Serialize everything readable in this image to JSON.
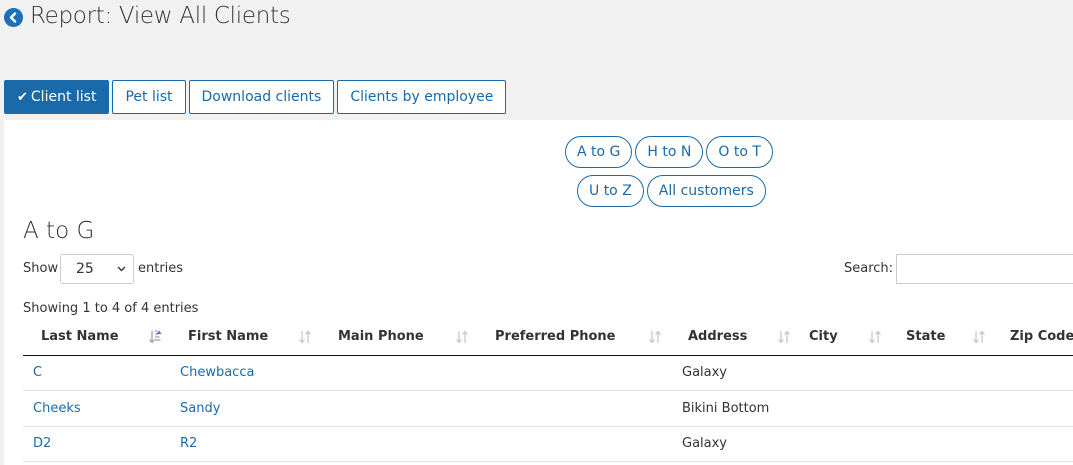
{
  "header": {
    "title": "Report: View All Clients"
  },
  "tabs": [
    {
      "label": "Client list",
      "active": true
    },
    {
      "label": "Pet list",
      "active": false
    },
    {
      "label": "Download clients",
      "active": false
    },
    {
      "label": "Clients by employee",
      "active": false
    }
  ],
  "alpha_filters": {
    "row1": [
      "A to G",
      "H to N",
      "O to T"
    ],
    "row2": [
      "U to Z",
      "All customers"
    ]
  },
  "section": {
    "title": "A to G"
  },
  "length_control": {
    "show_label": "Show",
    "value": "25",
    "entries_label": "entries"
  },
  "search": {
    "label": "Search:",
    "value": ""
  },
  "info_text": "Showing 1 to 4 of 4 entries",
  "table": {
    "columns": [
      "Last Name",
      "First Name",
      "Main Phone",
      "Preferred Phone",
      "Address",
      "City",
      "State",
      "Zip Code"
    ],
    "rows": [
      {
        "last_name": "C",
        "first_name": "Chewbacca",
        "main_phone": "",
        "preferred_phone": "",
        "address": "Galaxy",
        "city": "",
        "state": "",
        "zip": ""
      },
      {
        "last_name": "Cheeks",
        "first_name": "Sandy",
        "main_phone": "",
        "preferred_phone": "",
        "address": "Bikini Bottom",
        "city": "",
        "state": "",
        "zip": ""
      },
      {
        "last_name": "D2",
        "first_name": "R2",
        "main_phone": "",
        "preferred_phone": "",
        "address": "Galaxy",
        "city": "",
        "state": "",
        "zip": ""
      }
    ]
  },
  "colors": {
    "accent": "#1a6aa9",
    "background": "#f1f1f1"
  }
}
